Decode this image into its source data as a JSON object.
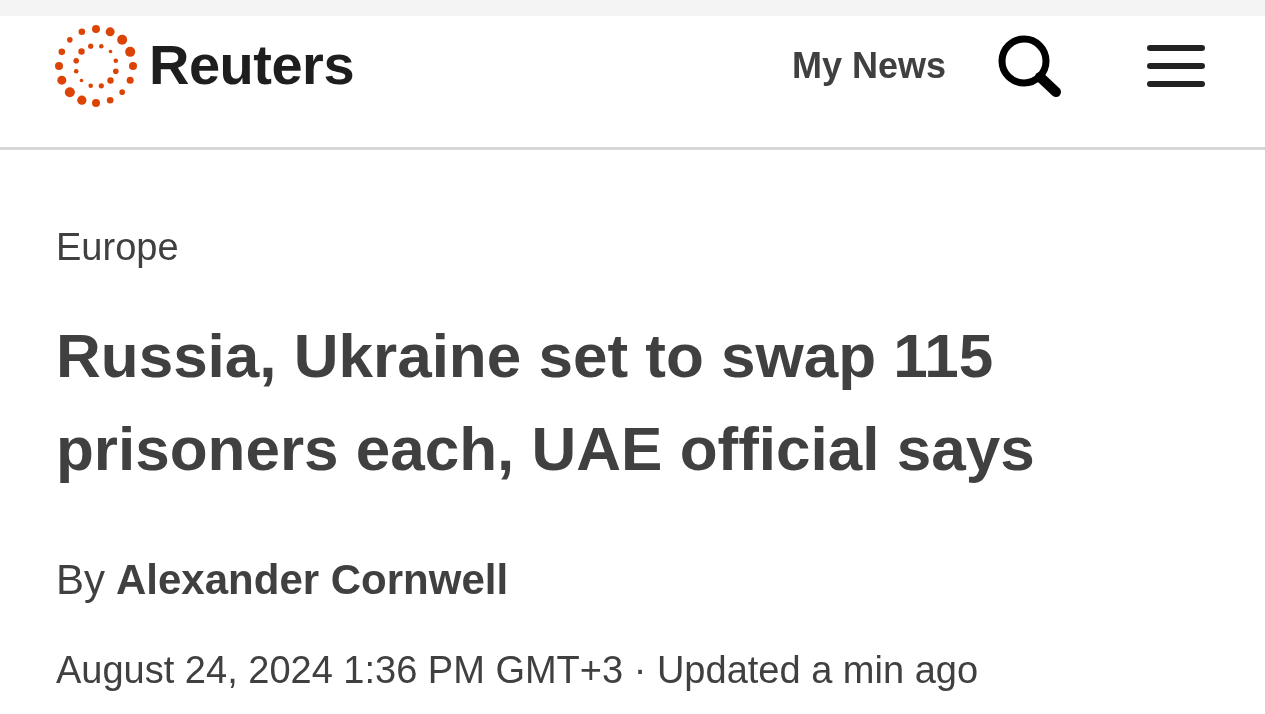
{
  "header": {
    "logo_text": "Reuters",
    "nav_link": "My News"
  },
  "article": {
    "section": "Europe",
    "headline": "Russia, Ukraine set to swap 115 prisoners each, UAE official says",
    "byline": {
      "prefix": "By",
      "author": "Alexander Cornwell"
    },
    "timestamp": "August 24, 2024 1:36 PM GMT+3 · Updated a min ago"
  }
}
